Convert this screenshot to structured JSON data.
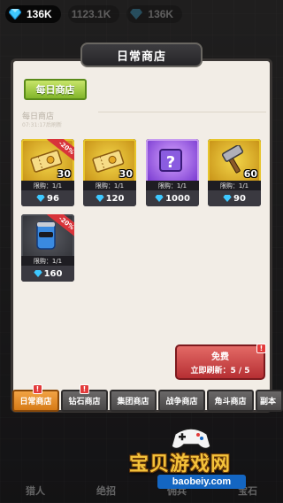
{
  "currency": {
    "gems": "136K",
    "ghost_values": [
      "1123.1K",
      "136K"
    ]
  },
  "bg_nav": [
    "猎人",
    "绝招",
    "佣兵",
    "宝石"
  ],
  "modal": {
    "title": "日常商店",
    "daily_button": "每日商店",
    "section_title": "每日商店",
    "section_time": "07:31:17后刷新"
  },
  "items": [
    {
      "name": "ticket",
      "qty": "30",
      "discount": "-20%",
      "limit": "限购：1/1",
      "price": "96",
      "rarity": "gold"
    },
    {
      "name": "ticket",
      "qty": "30",
      "discount": "",
      "limit": "限购：1/1",
      "price": "120",
      "rarity": "gold"
    },
    {
      "name": "mystery-box",
      "qty": "",
      "discount": "",
      "limit": "限购：1/1",
      "price": "1000",
      "rarity": "purple"
    },
    {
      "name": "hammer",
      "qty": "60",
      "discount": "",
      "limit": "限购：1/1",
      "price": "90",
      "rarity": "gold"
    },
    {
      "name": "drink-can",
      "qty": "",
      "discount": "-20%",
      "limit": "限购：1/1",
      "price": "160",
      "rarity": "blue"
    }
  ],
  "refresh": {
    "line1": "免费",
    "line2": "立即刷新：5 / 5",
    "badge": "!"
  },
  "tabs": [
    {
      "label": "日常商店",
      "active": true,
      "badge": "!"
    },
    {
      "label": "钻石商店",
      "active": false,
      "badge": "!"
    },
    {
      "label": "集团商店",
      "active": false,
      "badge": ""
    },
    {
      "label": "战争商店",
      "active": false,
      "badge": ""
    },
    {
      "label": "角斗商店",
      "active": false,
      "badge": ""
    },
    {
      "label": "副本",
      "active": false,
      "badge": ""
    }
  ],
  "watermark": {
    "main": "宝贝游戏网",
    "sub": "baobeiy.com"
  },
  "colors": {
    "gold": "#e7c52c",
    "purple": "#b070ff",
    "accent_tab": "#e38a20",
    "refresh_red": "#c23a3c"
  }
}
